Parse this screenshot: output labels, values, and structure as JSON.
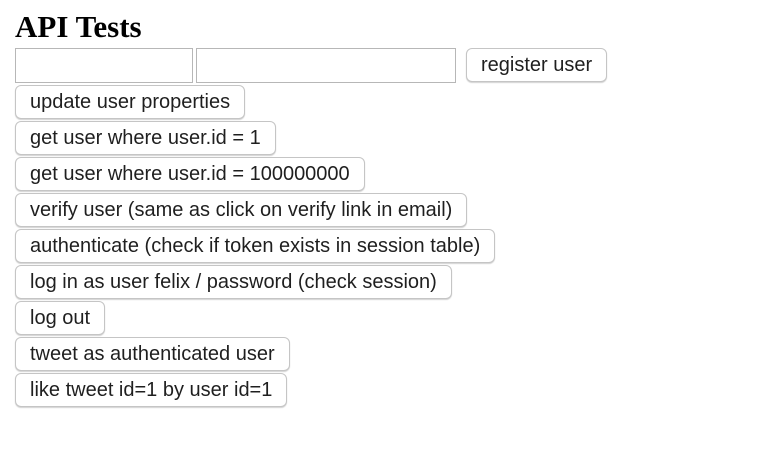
{
  "page": {
    "title": "API Tests"
  },
  "form": {
    "field1_value": "",
    "field2_value": "",
    "register_label": "register user"
  },
  "buttons": [
    {
      "label": "update user properties"
    },
    {
      "label": "get user where user.id = 1"
    },
    {
      "label": "get user where user.id = 100000000"
    },
    {
      "label": "verify user (same as click on verify link in email)"
    },
    {
      "label": "authenticate (check if token exists in session table)"
    },
    {
      "label": "log in as user felix / password (check session)"
    },
    {
      "label": "log out"
    },
    {
      "label": "tweet as authenticated user"
    },
    {
      "label": "like tweet id=1 by user id=1"
    }
  ]
}
